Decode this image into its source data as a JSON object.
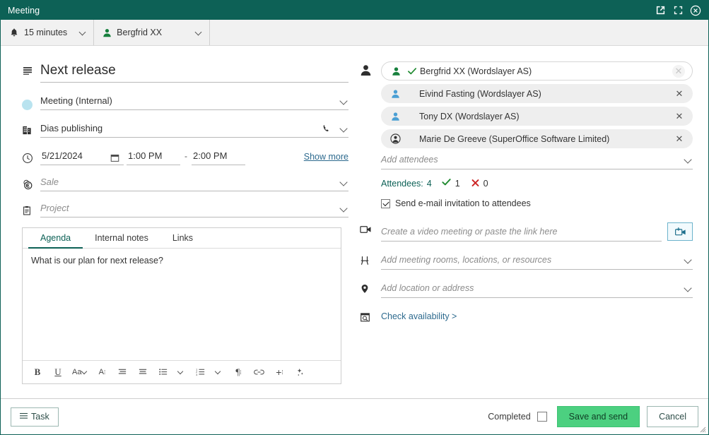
{
  "window": {
    "title": "Meeting",
    "buttons": [
      {
        "name": "pop-out-icon",
        "label": "Pop out"
      },
      {
        "name": "maximize-icon",
        "label": "Maximize"
      },
      {
        "name": "close-icon",
        "label": "Close"
      }
    ]
  },
  "toolbar": {
    "alarm": {
      "icon": "bell-icon",
      "label": "15 minutes"
    },
    "owner": {
      "icon": "person-icon",
      "label": "Bergfrid XX"
    }
  },
  "left": {
    "title": {
      "icon": "description-icon",
      "value": "Next release"
    },
    "type": {
      "icon": "category-color-dot",
      "value": "Meeting (Internal)"
    },
    "company": {
      "icon": "company-icon",
      "value": "Dias publishing",
      "phone_icon": "phone-icon"
    },
    "when": {
      "icon": "clock-icon",
      "date": "5/21/2024",
      "calendar_icon": "calendar-icon",
      "start_time": "1:00 PM",
      "separator": "-",
      "end_time": "2:00 PM",
      "show_more": "Show more"
    },
    "sale": {
      "icon": "sale-icon",
      "placeholder": "Sale"
    },
    "project": {
      "icon": "project-icon",
      "placeholder": "Project"
    },
    "editor": {
      "tabs": [
        {
          "label": "Agenda",
          "active": true
        },
        {
          "label": "Internal notes",
          "active": false
        },
        {
          "label": "Links",
          "active": false
        }
      ],
      "content": "What is our plan for next release?",
      "tools": [
        {
          "name": "bold-icon",
          "glyph": "B"
        },
        {
          "name": "underline-icon",
          "glyph": "U"
        },
        {
          "name": "font-size-icon",
          "glyph": "Aa"
        },
        {
          "name": "font-color-icon",
          "glyph": "A"
        },
        {
          "name": "align-left-icon",
          "glyph": ""
        },
        {
          "name": "align-center-icon",
          "glyph": ""
        },
        {
          "name": "bullet-list-icon",
          "glyph": ""
        },
        {
          "name": "numbered-list-icon",
          "glyph": ""
        },
        {
          "name": "paragraph-icon",
          "glyph": "¶"
        },
        {
          "name": "link-icon",
          "glyph": ""
        },
        {
          "name": "insert-icon",
          "glyph": "+"
        },
        {
          "name": "ai-sparkle-icon",
          "glyph": ""
        }
      ]
    }
  },
  "right": {
    "attendees_icon": "person-icon",
    "attendees": [
      {
        "name": "Bergfrid XX (Wordslayer AS)",
        "status": "accepted",
        "avatar": "person-green-icon",
        "first": true
      },
      {
        "name": "Eivind Fasting (Wordslayer AS)",
        "status": "none",
        "avatar": "person-blue-icon",
        "first": false
      },
      {
        "name": "Tony DX (Wordslayer AS)",
        "status": "none",
        "avatar": "person-blue-icon",
        "first": false
      },
      {
        "name": "Marie De Greeve (SuperOffice Software Limited)",
        "status": "none",
        "avatar": "person-circle-icon",
        "first": false
      }
    ],
    "add_attendees_placeholder": "Add attendees",
    "counts": {
      "label": "Attendees:",
      "total": "4",
      "accepted": "1",
      "declined": "0"
    },
    "send_invite": {
      "label": "Send e-mail invitation to attendees",
      "checked": true
    },
    "video": {
      "icon": "video-camera-icon",
      "placeholder": "Create a video meeting or paste the link here",
      "button_icon": "add-video-icon"
    },
    "resources": {
      "icon": "chair-icon",
      "placeholder": "Add meeting rooms, locations, or resources"
    },
    "location": {
      "icon": "location-pin-icon",
      "placeholder": "Add location or address"
    },
    "availability": {
      "icon": "calendar-search-icon",
      "label": "Check availability >"
    }
  },
  "footer": {
    "task_button": {
      "icon": "list-icon",
      "label": "Task"
    },
    "completed": {
      "label": "Completed",
      "checked": false
    },
    "save_label": "Save and send",
    "cancel_label": "Cancel"
  },
  "colors": {
    "brand_teal": "#0d6156",
    "accent_green": "#4cd080",
    "category_dot": "#b9e3ef",
    "link_blue": "#2d6a8e"
  }
}
